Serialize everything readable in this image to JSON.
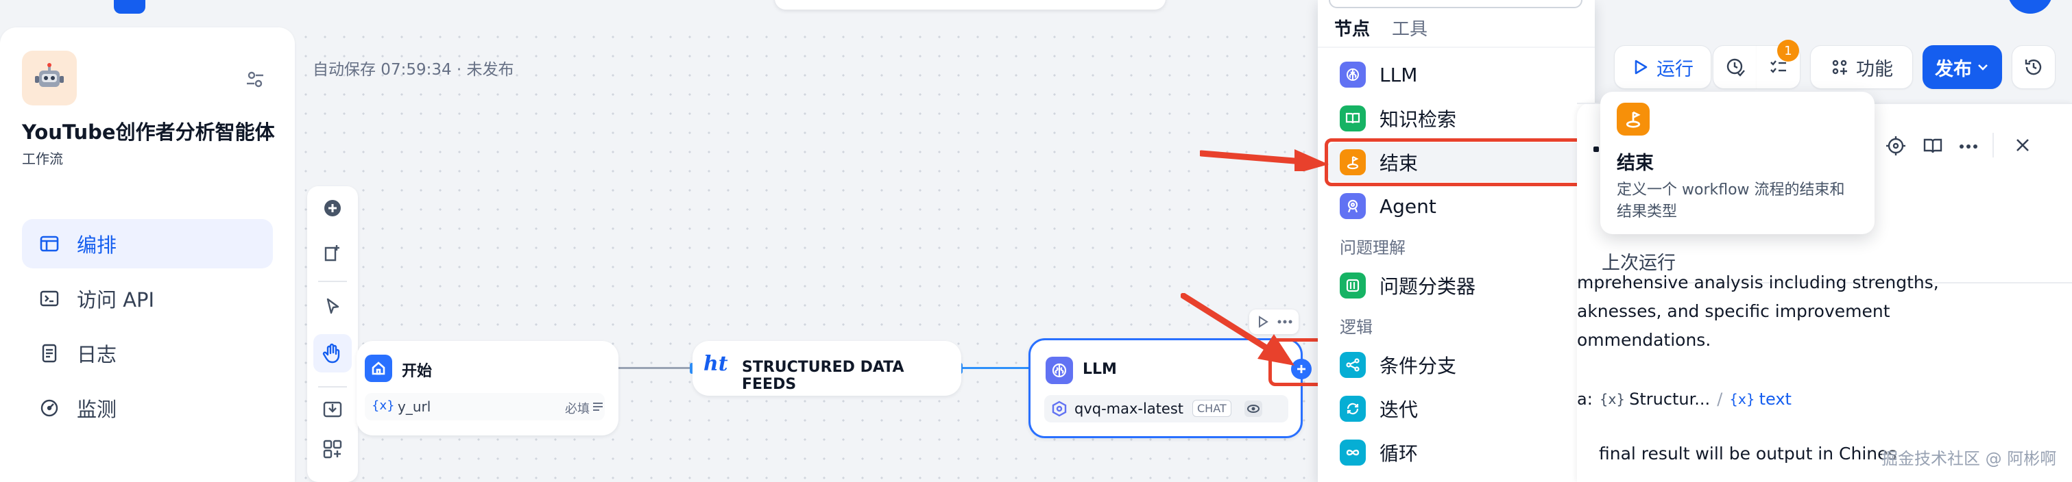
{
  "app": {
    "name": "YouTube创作者分析智能体",
    "type_label": "工作流",
    "autosave": "自动保存 07:59:34 · 未发布"
  },
  "sidebar": {
    "items": [
      {
        "label": "编排",
        "icon": "layout-icon",
        "active": true
      },
      {
        "label": "访问 API",
        "icon": "terminal-icon"
      },
      {
        "label": "日志",
        "icon": "document-icon"
      },
      {
        "label": "监测",
        "icon": "gauge-icon"
      }
    ]
  },
  "nodes": {
    "start": {
      "title": "开始",
      "var": "y_url",
      "required": "必填"
    },
    "sdf": {
      "title": "STRUCTURED DATA FEEDS",
      "logo": "ht"
    },
    "llm": {
      "title": "LLM",
      "model": "qvq-max-latest",
      "mode": "CHAT"
    }
  },
  "dropdown": {
    "tabs": [
      "节点",
      "工具"
    ],
    "items": [
      {
        "label": "LLM",
        "color": "#6172f3"
      },
      {
        "label": "知识检索",
        "color": "#16b364"
      },
      {
        "label": "结束",
        "color": "#f79009"
      },
      {
        "label": "Agent",
        "color": "#6172f3"
      }
    ],
    "group1": "问题理解",
    "items2": [
      {
        "label": "问题分类器",
        "color": "#16b364"
      }
    ],
    "group2": "逻辑",
    "items3": [
      {
        "label": "条件分支",
        "color": "#06aed4"
      },
      {
        "label": "迭代",
        "color": "#06aed4"
      },
      {
        "label": "循环",
        "color": "#06aed4"
      }
    ]
  },
  "toolbar": {
    "run": "运行",
    "badge": "1",
    "features": "功能",
    "publish": "发布",
    "accent": "#155eef"
  },
  "tooltip": {
    "title": "结束",
    "desc": "定义一个 workflow 流程的结束和结果类型"
  },
  "panel": {
    "last_run": "上次运行",
    "text_lines": [
      "mprehensive analysis including strengths,",
      "aknesses, and specific improvement",
      "ommendations."
    ],
    "var_prefix": "a:",
    "var1": "Structur...",
    "var2": "text",
    "footer_line": "final result will be output in Chines"
  },
  "watermark": "掘金技术社区 @ 阿彬啊"
}
